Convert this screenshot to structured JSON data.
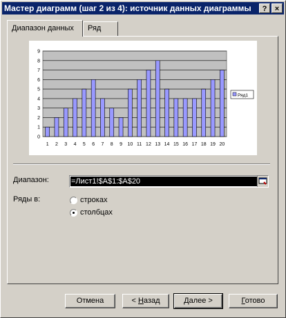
{
  "window": {
    "title": "Мастер диаграмм (шаг 2 из 4): источник данных диаграммы",
    "help_label": "?",
    "close_label": "×"
  },
  "tabs": [
    {
      "label": "Диапазон данных",
      "active": true
    },
    {
      "label": "Ряд",
      "active": false
    }
  ],
  "chart_data": {
    "type": "bar",
    "categories": [
      "1",
      "2",
      "3",
      "4",
      "5",
      "6",
      "7",
      "8",
      "9",
      "10",
      "11",
      "12",
      "13",
      "14",
      "15",
      "16",
      "17",
      "18",
      "19",
      "20"
    ],
    "series": [
      {
        "name": "Ряд1",
        "values": [
          1,
          2,
          3,
          4,
          5,
          6,
          4,
          3,
          2,
          5,
          6,
          7,
          8,
          5,
          4,
          4,
          4,
          5,
          6,
          7
        ],
        "color": "#9999ff"
      }
    ],
    "ylim": [
      0,
      9
    ],
    "yticks": [
      "0",
      "1",
      "2",
      "3",
      "4",
      "5",
      "6",
      "7",
      "8",
      "9"
    ],
    "plot_background": "#c0c0c0",
    "grid": true,
    "legend": "right"
  },
  "form": {
    "range_label": "Диапазон:",
    "range_value": "=Лист1!$A$1:$A$20",
    "series_in_label": "Ряды в:",
    "option_rows": "строках",
    "option_columns": "столбцах",
    "selected_option": "columns"
  },
  "buttons": {
    "cancel": "Отмена",
    "back_arrow": "< ",
    "back_hot": "Н",
    "back_rest": "азад",
    "next_hot": "Д",
    "next_rest": "алее >",
    "finish_hot": "Г",
    "finish_rest": "отово"
  }
}
